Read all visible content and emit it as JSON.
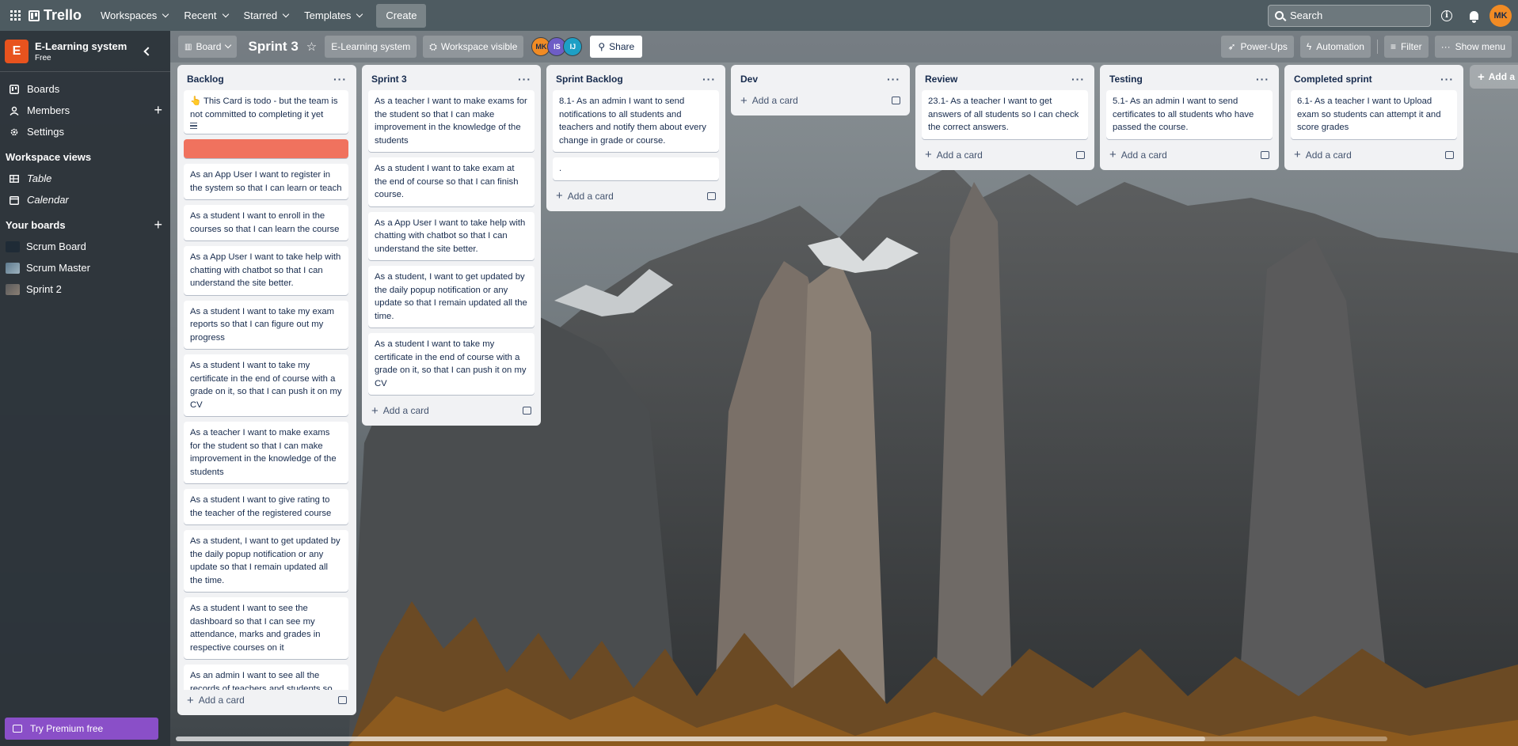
{
  "topnav": {
    "brand": "Trello",
    "menus": [
      "Workspaces",
      "Recent",
      "Starred",
      "Templates"
    ],
    "create_label": "Create",
    "search_placeholder": "Search",
    "user_initials": "MK"
  },
  "sidebar": {
    "workspace_initial": "E",
    "workspace_name": "E-Learning system",
    "workspace_plan": "Free",
    "items": [
      {
        "label": "Boards"
      },
      {
        "label": "Members"
      },
      {
        "label": "Settings"
      }
    ],
    "views_heading": "Workspace views",
    "views": [
      {
        "label": "Table"
      },
      {
        "label": "Calendar"
      }
    ],
    "boards_heading": "Your boards",
    "boards": [
      {
        "label": "Scrum Board"
      },
      {
        "label": "Scrum Master"
      },
      {
        "label": "Sprint 2"
      }
    ],
    "premium_label": "Try Premium free"
  },
  "board": {
    "view_label": "Board",
    "title": "Sprint 3",
    "workspace_label": "E-Learning system",
    "visibility_label": "Workspace visible",
    "members": [
      {
        "initials": "MK",
        "color": "#f18b24"
      },
      {
        "initials": "IS",
        "color": "#6e5dc6"
      },
      {
        "initials": "IJ",
        "color": "#1d9fc5"
      }
    ],
    "share_label": "Share",
    "powerups_label": "Power-Ups",
    "automation_label": "Automation",
    "filter_label": "Filter",
    "menu_label": "Show menu",
    "add_list_label": "Add a"
  },
  "lists": [
    {
      "title": "Backlog",
      "cards": [
        "👆 This Card is todo - but the team is not committed to completing it yet",
        "",
        "As an App User I want to register in the system so that I can learn or teach",
        "As a student I want to enroll in the courses so that I can learn the course",
        "As a App User I want to take help with chatting with chatbot so that I can understand the site better.",
        "As a student I want to take my exam reports so that I can figure out my progress",
        "As a student I want to take my certificate in the end of course with a grade on it, so that I can push it on my CV",
        "As a teacher I want to make exams for the student so that I can make improvement in the knowledge of the students",
        "As a student I want to give rating to the teacher of the registered course",
        "As a student, I want to get updated by the daily popup notification or any update so that I remain updated all the time.",
        "As a student I want to see the dashboard so that I can see my attendance, marks and grades in respective courses on it",
        "As an admin I want to see all the records of teachers and students so"
      ],
      "add_label": "Add a card"
    },
    {
      "title": "Sprint 3",
      "cards": [
        "As a teacher I want to make exams for the student so that I can make improvement in the knowledge of the students",
        "As a student I want to take exam at the end of course so that I can finish course.",
        "As a App User I want to take help with chatting with chatbot so that I can understand the site better.",
        "As a student, I want to get updated by the daily popup notification or any update so that I remain updated all the time.",
        "As a student I want to take my certificate in the end of course with a grade on it, so that I can push it on my CV"
      ],
      "add_label": "Add a card"
    },
    {
      "title": "Sprint Backlog",
      "cards": [
        "8.1- As an admin I want to send notifications to all students and teachers and notify them about every change in grade or course.",
        "."
      ],
      "add_label": "Add a card"
    },
    {
      "title": "Dev",
      "cards": [],
      "add_label": "Add a card"
    },
    {
      "title": "Review",
      "cards": [
        "23.1- As a teacher I want to get answers of all students so I can check the correct answers."
      ],
      "add_label": "Add a card"
    },
    {
      "title": "Testing",
      "cards": [
        "5.1- As an admin I want to send certificates to all students who have passed the course."
      ],
      "add_label": "Add a card"
    },
    {
      "title": "Completed sprint",
      "cards": [
        "6.1- As a teacher I want to Upload exam so students can attempt it and score grades"
      ],
      "add_label": "Add a card"
    }
  ],
  "colors": {
    "cover_red": "#f0725e",
    "premium_purple": "#8a4fc8",
    "workspace_orange": "#e8531e"
  }
}
